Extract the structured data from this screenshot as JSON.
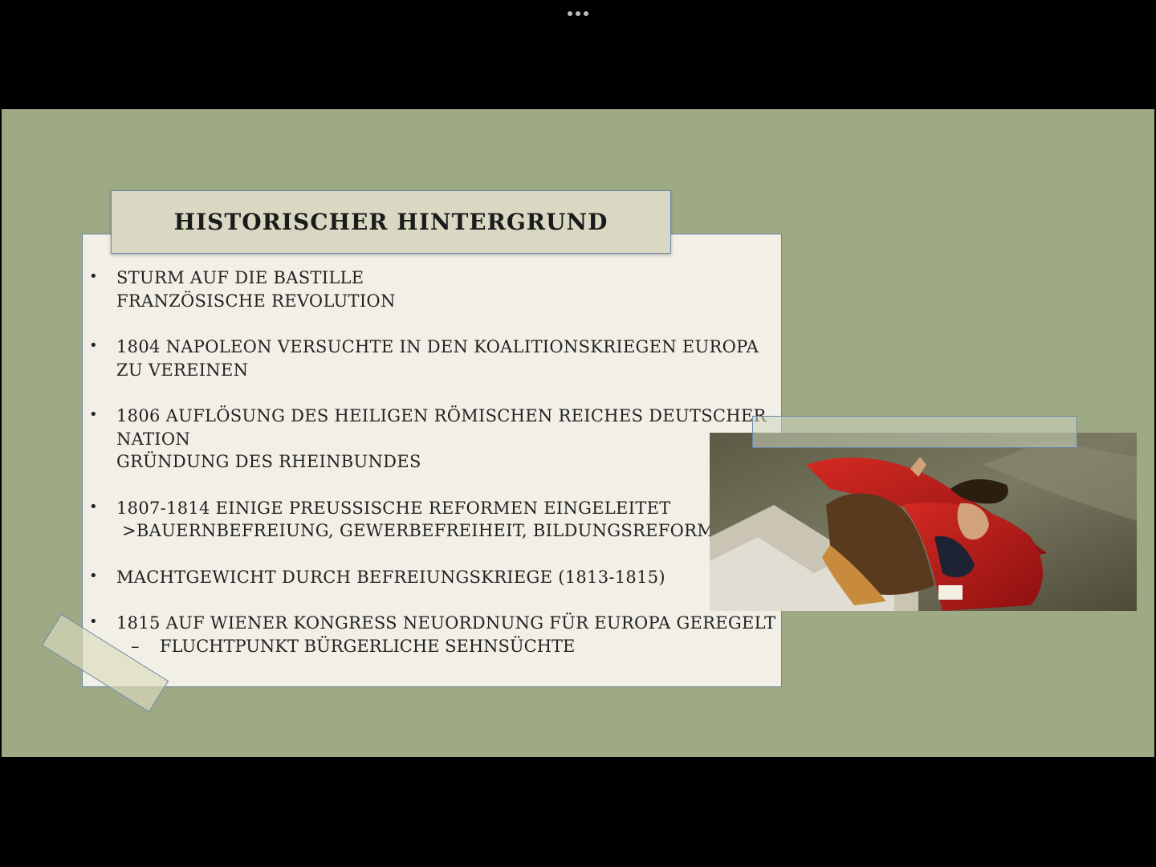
{
  "window": {
    "menu_icon": "more-dots-icon"
  },
  "slide": {
    "title": "HISTORISCHER HINTERGRUND",
    "background_color": "#9daa84",
    "bullets": [
      {
        "lines": [
          "Sturm auf die Bastille",
          "Französische Revolution"
        ]
      },
      {
        "lines": [
          "1804 Napoleon versuchte in den Koalitionskriegen Europa",
          "zu vereinen"
        ]
      },
      {
        "lines": [
          "1806 Auflösung des Heiligen Römischen Reiches Deutscher",
          "Nation",
          "Gründung des Rheinbundes"
        ]
      },
      {
        "lines": [
          "1807-1814 einige preussische Reformen eingeleitet",
          " >Bauernbefreiung, Gewerbefreiheit, Bildungsreform"
        ]
      },
      {
        "lines": [
          "Machtgewicht durch Befreiungskriege (1813-1815)"
        ]
      },
      {
        "lines": [
          "1815 auf Wiener Kongress Neuordnung für Europa geregelt"
        ],
        "sub": "Fluchtpunkt bürgerliche Sehnsüchte"
      }
    ],
    "bullet_char": "•",
    "sub_dash": "–",
    "image": {
      "subject": "painting of Napoleon on horseback with red cloak"
    }
  }
}
